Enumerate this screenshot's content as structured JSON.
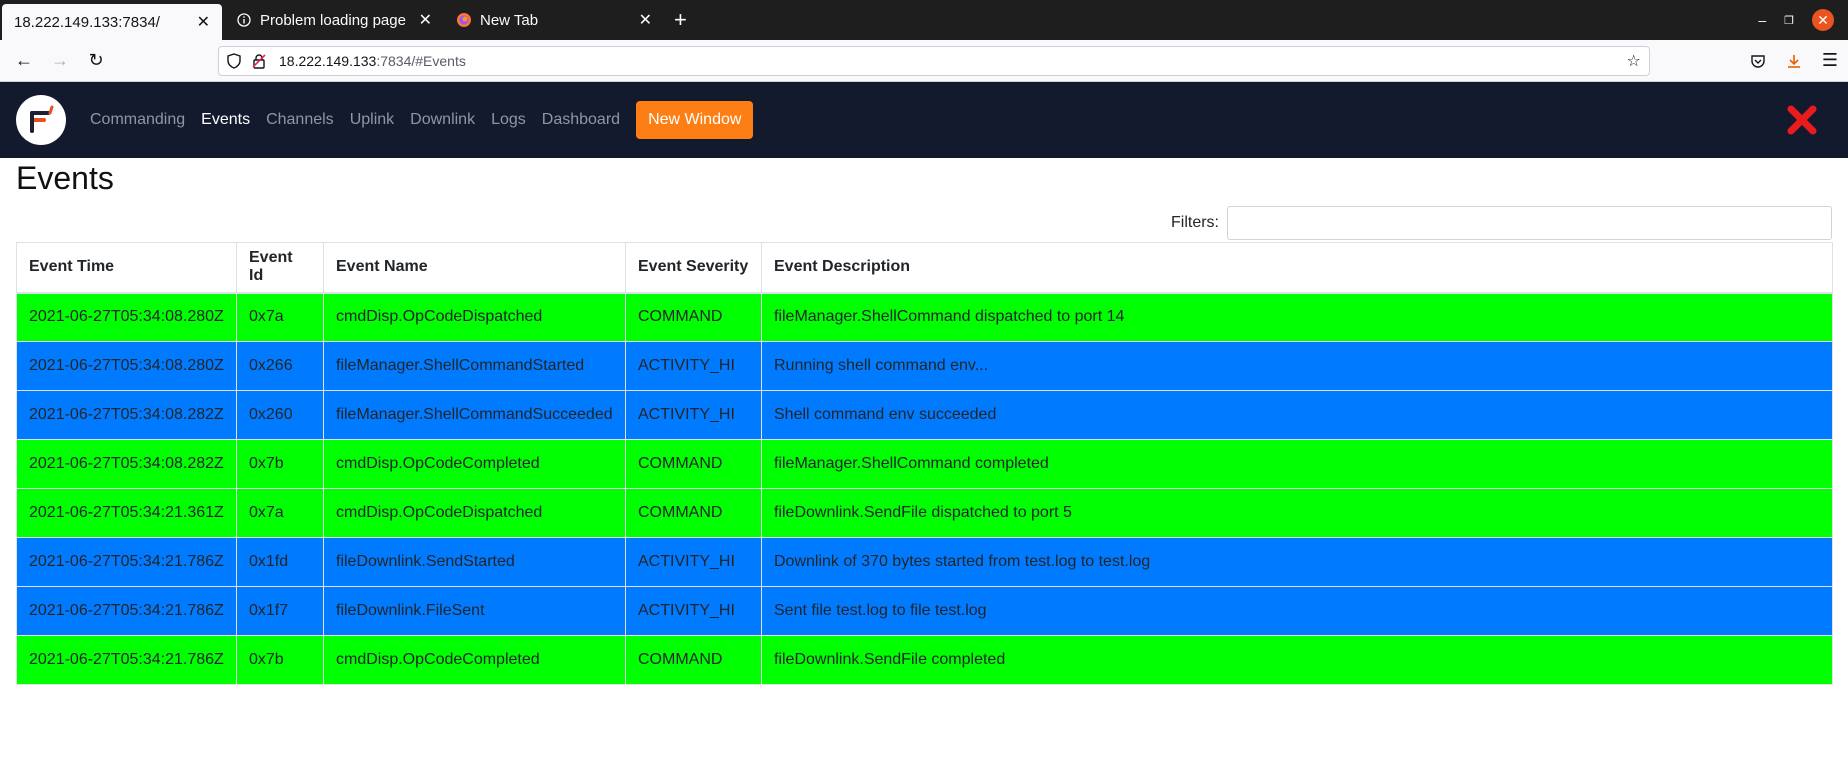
{
  "browser": {
    "tabs": [
      {
        "title": "18.222.149.133:7834/",
        "active": true
      },
      {
        "title": "Problem loading page",
        "active": false
      },
      {
        "title": "New Tab",
        "active": false
      }
    ],
    "url": {
      "host": "18.222.149.133",
      "rest": ":7834/#Events"
    }
  },
  "app": {
    "nav": [
      "Commanding",
      "Events",
      "Channels",
      "Uplink",
      "Downlink",
      "Logs",
      "Dashboard"
    ],
    "active_nav": "Events",
    "new_window_label": "New Window"
  },
  "page": {
    "title": "Events",
    "filters_label": "Filters:",
    "filters_value": ""
  },
  "colors": {
    "command": "#00ff00",
    "activity_hi": "#007bff",
    "appbar": "#141a2e",
    "new_window": "#fd7e14"
  },
  "table": {
    "headers": [
      "Event Time",
      "Event Id",
      "Event Name",
      "Event Severity",
      "Event Description"
    ],
    "rows": [
      {
        "time": "2021-06-27T05:34:08.280Z",
        "id": "0x7a",
        "name": "cmdDisp.OpCodeDispatched",
        "severity": "COMMAND",
        "description": "fileManager.ShellCommand dispatched to port 14"
      },
      {
        "time": "2021-06-27T05:34:08.280Z",
        "id": "0x266",
        "name": "fileManager.ShellCommandStarted",
        "severity": "ACTIVITY_HI",
        "description": "Running shell command env..."
      },
      {
        "time": "2021-06-27T05:34:08.282Z",
        "id": "0x260",
        "name": "fileManager.ShellCommandSucceeded",
        "severity": "ACTIVITY_HI",
        "description": "Shell command env succeeded"
      },
      {
        "time": "2021-06-27T05:34:08.282Z",
        "id": "0x7b",
        "name": "cmdDisp.OpCodeCompleted",
        "severity": "COMMAND",
        "description": "fileManager.ShellCommand completed"
      },
      {
        "time": "2021-06-27T05:34:21.361Z",
        "id": "0x7a",
        "name": "cmdDisp.OpCodeDispatched",
        "severity": "COMMAND",
        "description": "fileDownlink.SendFile dispatched to port 5"
      },
      {
        "time": "2021-06-27T05:34:21.786Z",
        "id": "0x1fd",
        "name": "fileDownlink.SendStarted",
        "severity": "ACTIVITY_HI",
        "description": "Downlink of 370 bytes started from test.log to test.log"
      },
      {
        "time": "2021-06-27T05:34:21.786Z",
        "id": "0x1f7",
        "name": "fileDownlink.FileSent",
        "severity": "ACTIVITY_HI",
        "description": "Sent file test.log to file test.log"
      },
      {
        "time": "2021-06-27T05:34:21.786Z",
        "id": "0x7b",
        "name": "cmdDisp.OpCodeCompleted",
        "severity": "COMMAND",
        "description": "fileDownlink.SendFile completed"
      }
    ]
  }
}
